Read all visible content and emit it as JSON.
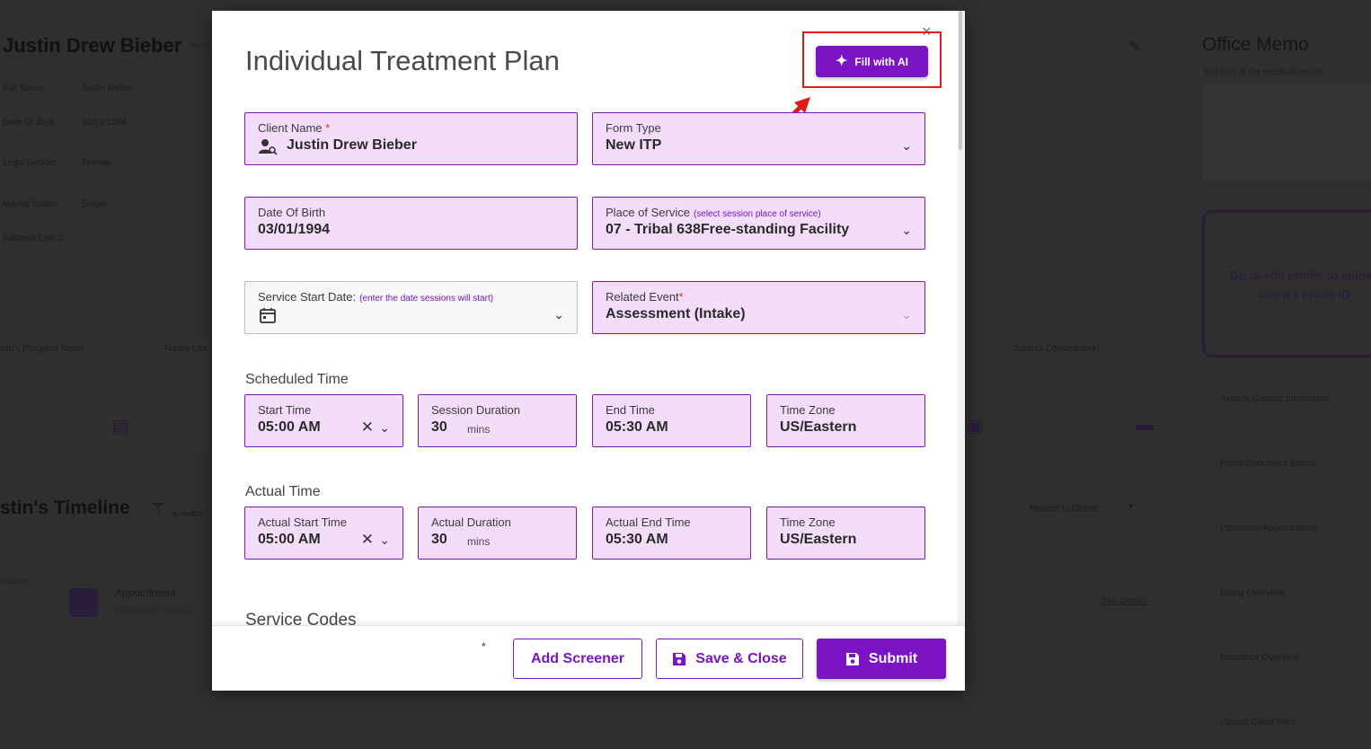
{
  "background": {
    "client_name": "Justin Drew Bieber",
    "pronouns": "he/hi",
    "details": [
      {
        "label": "Full Name:",
        "value": "Justin Bieber"
      },
      {
        "label": "Date Of Birth:",
        "value": "03/01/1994"
      },
      {
        "label": "Legal Gender:",
        "value": "Female"
      },
      {
        "label": "Marital Status:",
        "value": "Single"
      },
      {
        "label": "Address Line 2:",
        "value": ""
      }
    ],
    "office_memo_title": "Office Memo",
    "office_memo_sub": "*not part of the medical record",
    "photo_text": "Go to edit profile to upload client's photo ID",
    "side_items": [
      "Justin's Contact Information",
      "Portal Document Status",
      "Upcoming Appointments",
      "Billing Overview",
      "Insurance Overview",
      "Upload Client Files"
    ],
    "cards": [
      "stin's Progress Notes",
      "Forms Libr",
      "Justin's Conversation"
    ],
    "timeline_title": "stin's Timeline",
    "realtime_label": "a realtim",
    "sort_label": "Newest to Oldest",
    "timeline_date": "01/24/25",
    "appointment_title": "Appointment",
    "appointment_sub": "Appointment Schedul",
    "see_details": "See Details"
  },
  "modal": {
    "title": "Individual Treatment Plan",
    "close_label": "×",
    "fill_ai_label": "Fill with AI",
    "client_name": {
      "label": "Client Name",
      "required": "*",
      "value": "Justin Drew Bieber"
    },
    "form_type": {
      "label": "Form Type",
      "value": "New ITP"
    },
    "dob": {
      "label": "Date Of Birth",
      "value": "03/01/1994"
    },
    "place_of_service": {
      "label": "Place of Service",
      "hint": "(select session place of service)",
      "value": "07 - Tribal 638Free-standing Facility"
    },
    "service_start": {
      "label": "Service Start Date:",
      "hint": "(enter the date sessions will start)",
      "value": ""
    },
    "related_event": {
      "label": "Related Event",
      "required": "*",
      "value": "Assessment (Intake)"
    },
    "scheduled_section": "Scheduled Time",
    "scheduled": {
      "start_label": "Start Time",
      "start_value": "05:00 AM",
      "duration_label": "Session Duration",
      "duration_value": "30",
      "duration_unit": "mins",
      "end_label": "End Time",
      "end_value": "05:30 AM",
      "tz_label": "Time Zone",
      "tz_value": "US/Eastern"
    },
    "actual_section": "Actual Time",
    "actual": {
      "start_label": "Actual Start Time",
      "start_value": "05:00 AM",
      "duration_label": "Actual Duration",
      "duration_value": "30",
      "duration_unit": "mins",
      "end_label": "Actual End Time",
      "end_value": "05:30 AM",
      "tz_label": "Time Zone",
      "tz_value": "US/Eastern"
    },
    "service_codes_section": "Service Codes",
    "footer": {
      "asterisk": "*",
      "add_screener": "Add Screener",
      "save_close": "Save & Close",
      "submit": "Submit"
    }
  },
  "colors": {
    "accent": "#7a14c4",
    "field_bg": "#f4dcfb",
    "highlight": "#e0191b"
  }
}
